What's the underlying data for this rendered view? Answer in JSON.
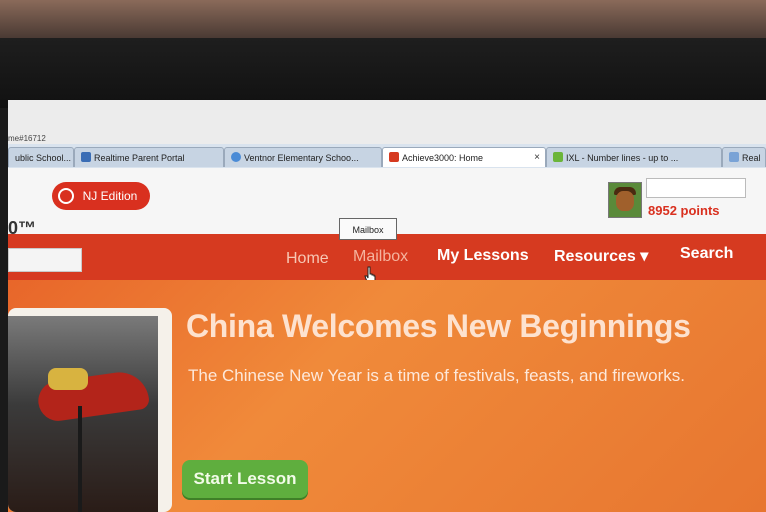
{
  "browser": {
    "url_fragment": "me#16712",
    "tabs": [
      {
        "label": "ublic School...",
        "active": false
      },
      {
        "label": "Realtime Parent Portal",
        "active": false
      },
      {
        "label": "Ventnor Elementary Schoo...",
        "active": false
      },
      {
        "label": "Achieve3000: Home",
        "active": true,
        "close": "×"
      },
      {
        "label": "IXL - Number lines - up to ...",
        "active": false
      },
      {
        "label": "Real",
        "active": false
      }
    ]
  },
  "header": {
    "edition_label": "NJ Edition",
    "logo_fragment": "0™",
    "points_label": "8952 points"
  },
  "nav": {
    "items": [
      "Home",
      "Mailbox",
      "My Lessons",
      "Resources ▾",
      "Search"
    ],
    "tooltip": "Mailbox"
  },
  "hero": {
    "title": "China Welcomes New Beginnings",
    "subtitle": "The Chinese New Year is a time of festivals, feasts, and fireworks.",
    "cta_label": "Start Lesson"
  },
  "colors": {
    "brand_red": "#d63a20",
    "hero_orange": "#ec7a33",
    "cta_green": "#5fae3e"
  }
}
